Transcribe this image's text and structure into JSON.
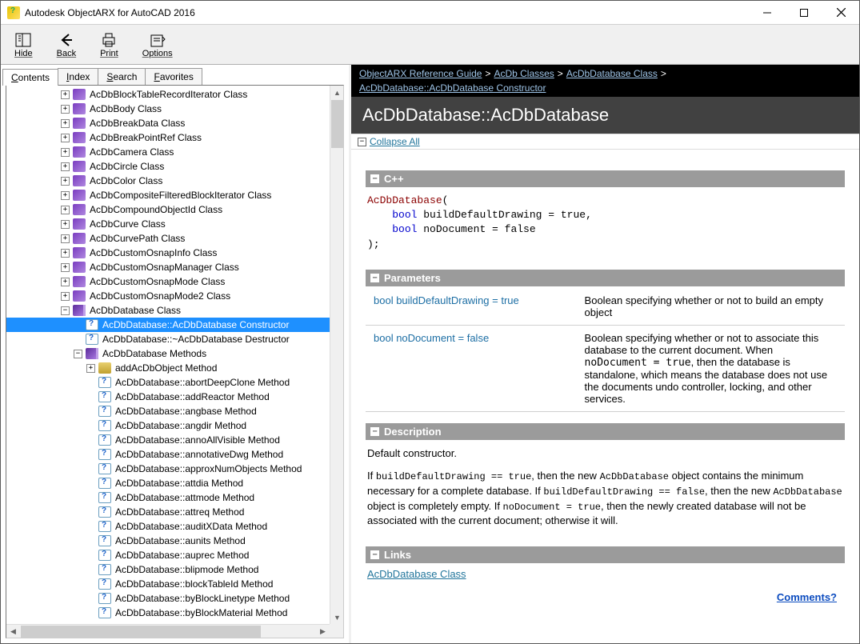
{
  "window": {
    "title": "Autodesk ObjectARX for AutoCAD 2016"
  },
  "toolbar": [
    {
      "label": "Hide",
      "icon": "hide-icon"
    },
    {
      "label": "Back",
      "icon": "back-icon"
    },
    {
      "label": "Print",
      "icon": "print-icon"
    },
    {
      "label": "Options",
      "icon": "options-icon"
    }
  ],
  "tabs": [
    {
      "label": "Contents",
      "active": true
    },
    {
      "label": "Index",
      "active": false
    },
    {
      "label": "Search",
      "active": false
    },
    {
      "label": "Favorites",
      "active": false
    }
  ],
  "tree": [
    {
      "indent": 4,
      "exp": "+",
      "icon": "class",
      "label": "AcDbBlockTableRecordIterator Class"
    },
    {
      "indent": 4,
      "exp": "+",
      "icon": "class",
      "label": "AcDbBody Class"
    },
    {
      "indent": 4,
      "exp": "+",
      "icon": "class",
      "label": "AcDbBreakData Class"
    },
    {
      "indent": 4,
      "exp": "+",
      "icon": "class",
      "label": "AcDbBreakPointRef Class"
    },
    {
      "indent": 4,
      "exp": "+",
      "icon": "class",
      "label": "AcDbCamera Class"
    },
    {
      "indent": 4,
      "exp": "+",
      "icon": "class",
      "label": "AcDbCircle Class"
    },
    {
      "indent": 4,
      "exp": "+",
      "icon": "class",
      "label": "AcDbColor Class"
    },
    {
      "indent": 4,
      "exp": "+",
      "icon": "class",
      "label": "AcDbCompositeFilteredBlockIterator Class"
    },
    {
      "indent": 4,
      "exp": "+",
      "icon": "class",
      "label": "AcDbCompoundObjectId Class"
    },
    {
      "indent": 4,
      "exp": "+",
      "icon": "class",
      "label": "AcDbCurve Class"
    },
    {
      "indent": 4,
      "exp": "+",
      "icon": "class",
      "label": "AcDbCurvePath Class"
    },
    {
      "indent": 4,
      "exp": "+",
      "icon": "class",
      "label": "AcDbCustomOsnapInfo Class"
    },
    {
      "indent": 4,
      "exp": "+",
      "icon": "class",
      "label": "AcDbCustomOsnapManager Class"
    },
    {
      "indent": 4,
      "exp": "+",
      "icon": "class",
      "label": "AcDbCustomOsnapMode Class"
    },
    {
      "indent": 4,
      "exp": "+",
      "icon": "class",
      "label": "AcDbCustomOsnapMode2 Class"
    },
    {
      "indent": 4,
      "exp": "-",
      "icon": "book",
      "label": "AcDbDatabase Class"
    },
    {
      "indent": 5,
      "exp": " ",
      "icon": "question",
      "label": "AcDbDatabase::AcDbDatabase Constructor",
      "selected": true
    },
    {
      "indent": 5,
      "exp": " ",
      "icon": "question",
      "label": "AcDbDatabase::~AcDbDatabase Destructor"
    },
    {
      "indent": 5,
      "exp": "-",
      "icon": "book",
      "label": "AcDbDatabase Methods"
    },
    {
      "indent": 6,
      "exp": "+",
      "icon": "folder",
      "label": "addAcDbObject Method"
    },
    {
      "indent": 6,
      "exp": " ",
      "icon": "question",
      "label": "AcDbDatabase::abortDeepClone Method"
    },
    {
      "indent": 6,
      "exp": " ",
      "icon": "question",
      "label": "AcDbDatabase::addReactor Method"
    },
    {
      "indent": 6,
      "exp": " ",
      "icon": "question",
      "label": "AcDbDatabase::angbase Method"
    },
    {
      "indent": 6,
      "exp": " ",
      "icon": "question",
      "label": "AcDbDatabase::angdir Method"
    },
    {
      "indent": 6,
      "exp": " ",
      "icon": "question",
      "label": "AcDbDatabase::annoAllVisible Method"
    },
    {
      "indent": 6,
      "exp": " ",
      "icon": "question",
      "label": "AcDbDatabase::annotativeDwg Method"
    },
    {
      "indent": 6,
      "exp": " ",
      "icon": "question",
      "label": "AcDbDatabase::approxNumObjects Method"
    },
    {
      "indent": 6,
      "exp": " ",
      "icon": "question",
      "label": "AcDbDatabase::attdia Method"
    },
    {
      "indent": 6,
      "exp": " ",
      "icon": "question",
      "label": "AcDbDatabase::attmode Method"
    },
    {
      "indent": 6,
      "exp": " ",
      "icon": "question",
      "label": "AcDbDatabase::attreq Method"
    },
    {
      "indent": 6,
      "exp": " ",
      "icon": "question",
      "label": "AcDbDatabase::auditXData Method"
    },
    {
      "indent": 6,
      "exp": " ",
      "icon": "question",
      "label": "AcDbDatabase::aunits Method"
    },
    {
      "indent": 6,
      "exp": " ",
      "icon": "question",
      "label": "AcDbDatabase::auprec Method"
    },
    {
      "indent": 6,
      "exp": " ",
      "icon": "question",
      "label": "AcDbDatabase::blipmode Method"
    },
    {
      "indent": 6,
      "exp": " ",
      "icon": "question",
      "label": "AcDbDatabase::blockTableId Method"
    },
    {
      "indent": 6,
      "exp": " ",
      "icon": "question",
      "label": "AcDbDatabase::byBlockLinetype Method"
    },
    {
      "indent": 6,
      "exp": " ",
      "icon": "question",
      "label": "AcDbDatabase::byBlockMaterial Method"
    }
  ],
  "breadcrumb": {
    "items": [
      {
        "text": "ObjectARX Reference Guide",
        "link": true
      },
      {
        "text": "AcDb Classes",
        "link": true
      },
      {
        "text": "AcDbDatabase Class",
        "link": true
      },
      {
        "text": "AcDbDatabase::AcDbDatabase Constructor",
        "link": true
      }
    ]
  },
  "page": {
    "title": "AcDbDatabase::AcDbDatabase",
    "collapse": "Collapse All"
  },
  "sections": {
    "cpp": {
      "header": "C++",
      "code_line1_a": "AcDbDatabase",
      "code_line1_b": "(",
      "code_line2_kw": "bool",
      "code_line2_rest": " buildDefaultDrawing = true,",
      "code_line3_kw": "bool",
      "code_line3_rest": " noDocument = false",
      "code_line4": ");"
    },
    "params": {
      "header": "Parameters",
      "rows": [
        {
          "sig": "bool buildDefaultDrawing = true",
          "desc": "Boolean specifying whether or not to build an empty object"
        },
        {
          "sig": "bool noDocument = false",
          "desc_pre": "Boolean specifying whether or not to associate this database to the current document. When ",
          "code": "noDocument = true",
          "desc_post": ", then the database is standalone, which means the database does not use the documents undo controller, locking, and other services."
        }
      ]
    },
    "desc": {
      "header": "Description",
      "p1": "Default constructor.",
      "p2_a": "If ",
      "p2_code1": "buildDefaultDrawing == true",
      "p2_b": ", then the new ",
      "p2_code2": "AcDbDatabase",
      "p2_c": " object contains the minimum necessary for a complete database. If ",
      "p2_code3": "buildDefaultDrawing == false",
      "p2_d": ", then the new ",
      "p2_code4": "AcDbDatabase",
      "p2_e": " object is completely empty. If ",
      "p2_code5": "noDocument = true",
      "p2_f": ", then the newly created database will not be associated with the current document; otherwise it will."
    },
    "links": {
      "header": "Links",
      "items": [
        "AcDbDatabase Class"
      ]
    },
    "comments": "Comments?"
  }
}
